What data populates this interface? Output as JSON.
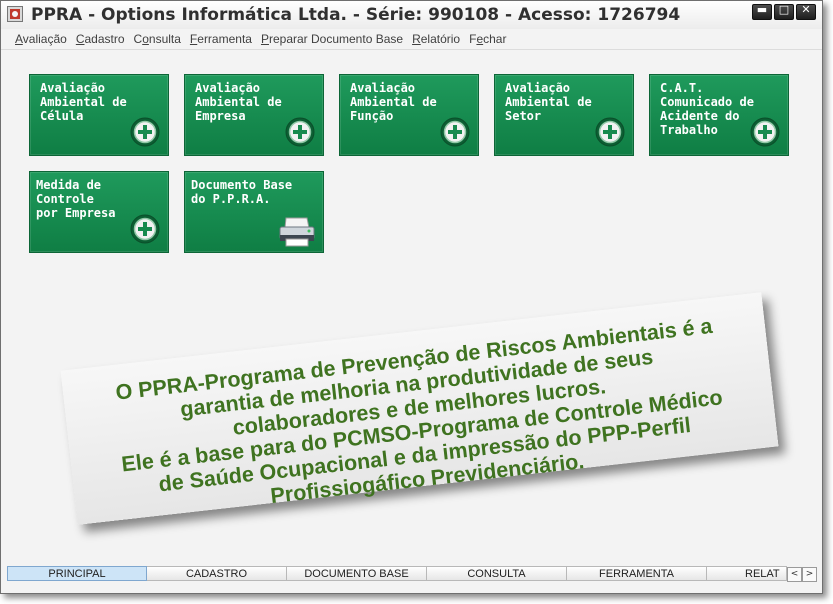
{
  "window": {
    "title": "PPRA - Options Informática Ltda. - Série: 990108 - Acesso: 1726794",
    "buttons": [
      "minimize",
      "maximize",
      "close"
    ]
  },
  "menu": [
    {
      "label": "Avaliação",
      "access_key": "A"
    },
    {
      "label": "Cadastro",
      "access_key": "C"
    },
    {
      "label": "Consulta",
      "access_key": "o"
    },
    {
      "label": "Ferramenta",
      "access_key": "F"
    },
    {
      "label": "Preparar Documento Base",
      "access_key": "P"
    },
    {
      "label": "Relatório",
      "access_key": "R"
    },
    {
      "label": "Fechar",
      "access_key": "e"
    }
  ],
  "tiles": [
    {
      "label": "Avaliação\nAmbiental de\nCélula",
      "icon": "plus-circle-icon"
    },
    {
      "label": "Avaliação\nAmbiental de\nEmpresa",
      "icon": "plus-circle-icon"
    },
    {
      "label": "Avaliação\nAmbiental de\nFunção",
      "icon": "plus-circle-icon"
    },
    {
      "label": "Avaliação\nAmbiental de\nSetor",
      "icon": "plus-circle-icon"
    },
    {
      "label": "C.A.T.\nComunicado de\nAcidente do\nTrabalho",
      "icon": "plus-circle-icon"
    },
    {
      "label": "Medida de Controle\npor Empresa",
      "icon": "plus-circle-icon"
    },
    {
      "label": "Documento Base\ndo P.P.R.A.",
      "icon": "printer-icon"
    }
  ],
  "slogan": {
    "lines": [
      "O PPRA-Programa de Prevenção de Riscos Ambientais é a",
      "garantia de melhoria na produtividade de seus",
      "colaboradores e de melhores lucros.",
      "Ele é a base para do PCMSO-Programa de Controle Médico",
      "de Saúde Ocupacional e da impressão do PPP-Perfil",
      "Profissiogáfico Previdenciário."
    ],
    "color": "#3f7320"
  },
  "tabs": [
    {
      "label": "PRINCIPAL",
      "active": true
    },
    {
      "label": "CADASTRO",
      "active": false
    },
    {
      "label": "DOCUMENTO BASE",
      "active": false
    },
    {
      "label": "CONSULTA",
      "active": false
    },
    {
      "label": "FERRAMENTA",
      "active": false
    },
    {
      "label": "RELAT",
      "active": false
    }
  ],
  "tab_scroll": {
    "left": "<",
    "right": ">"
  },
  "colors": {
    "tile_green": "#1a8f52",
    "slogan_text": "#3f7320"
  }
}
